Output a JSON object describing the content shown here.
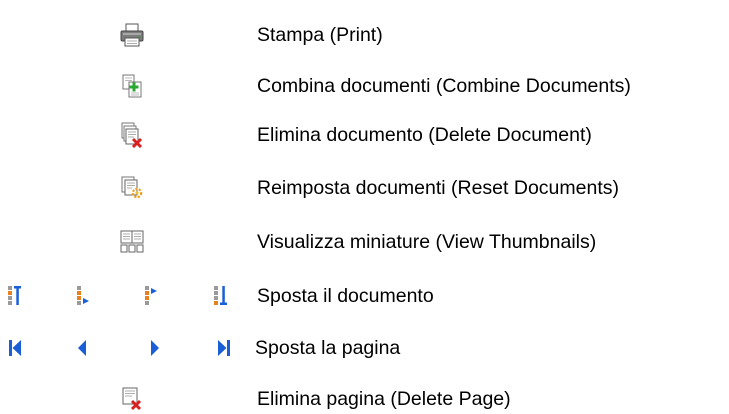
{
  "items": [
    {
      "label": "Stampa (Print)",
      "icons": [
        "printer-icon"
      ]
    },
    {
      "label": "Combina documenti (Combine Documents)",
      "icons": [
        "combine-documents-icon"
      ]
    },
    {
      "label": "Elimina documento (Delete Document)",
      "icons": [
        "delete-document-icon"
      ]
    },
    {
      "label": "Reimposta documenti (Reset Documents)",
      "icons": [
        "reset-documents-icon"
      ]
    },
    {
      "label": "Visualizza miniature (View Thumbnails)",
      "icons": [
        "view-thumbnails-icon"
      ]
    },
    {
      "label": "Sposta il documento",
      "icons": [
        "move-document-first-icon",
        "move-document-up-icon",
        "move-document-down-icon",
        "move-document-last-icon"
      ]
    },
    {
      "label": "Sposta la pagina",
      "icons": [
        "first-page-icon",
        "previous-page-icon",
        "next-page-icon",
        "last-page-icon"
      ]
    },
    {
      "label": "Elimina pagina (Delete Page)",
      "icons": [
        "delete-page-icon"
      ]
    }
  ],
  "colors": {
    "text": "#000000",
    "nav_blue": "#1a5fd6",
    "delete_red": "#d82020",
    "add_green": "#2aa832",
    "reset_orange": "#f0a020",
    "page_gray": "#8c8c8c"
  }
}
